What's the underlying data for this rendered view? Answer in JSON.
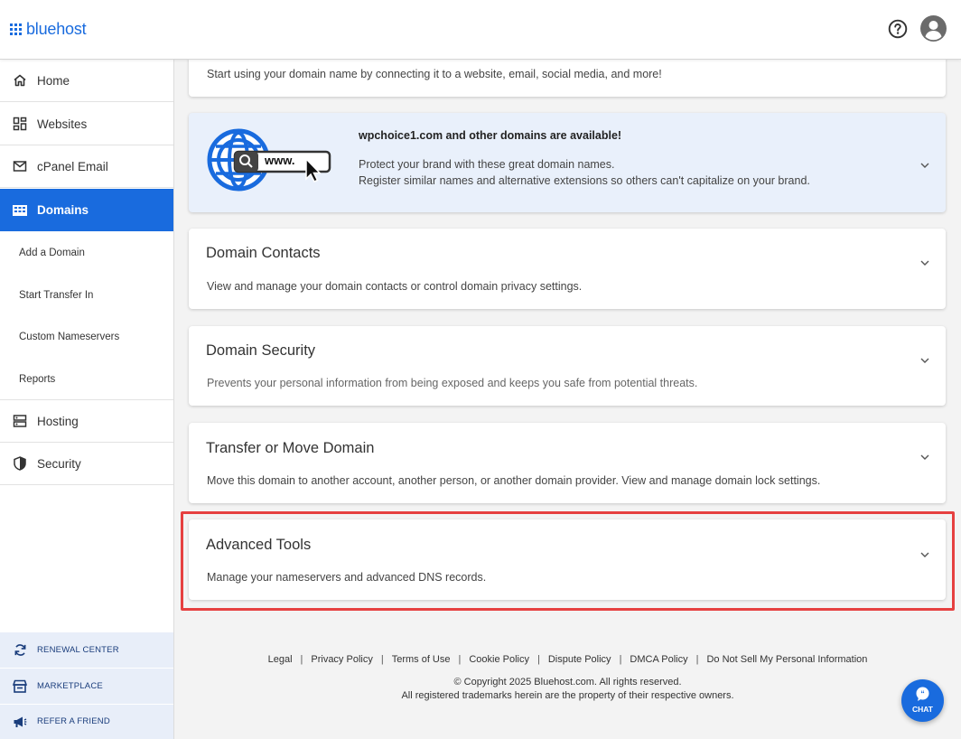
{
  "brand": {
    "name": "bluehost",
    "color": "#196bde"
  },
  "header": {
    "help_icon": "question-circle-icon",
    "avatar_icon": "user-avatar-icon"
  },
  "sidebar": {
    "items": [
      {
        "label": "Home",
        "icon": "home-icon"
      },
      {
        "label": "Websites",
        "icon": "dashboard-grid-icon"
      },
      {
        "label": "cPanel Email",
        "icon": "envelope-icon"
      },
      {
        "label": "Domains",
        "icon": "domains-building-icon",
        "active": true
      },
      {
        "label": "Hosting",
        "icon": "server-icon"
      },
      {
        "label": "Security",
        "icon": "shield-icon"
      }
    ],
    "sub_items": [
      {
        "label": "Add a Domain"
      },
      {
        "label": "Start Transfer In"
      },
      {
        "label": "Custom Nameservers"
      },
      {
        "label": "Reports"
      }
    ],
    "bottom": [
      {
        "label": "RENEWAL CENTER",
        "icon": "refresh-icon"
      },
      {
        "label": "MARKETPLACE",
        "icon": "store-icon"
      },
      {
        "label": "REFER A FRIEND",
        "icon": "megaphone-icon"
      }
    ]
  },
  "main": {
    "top_card": {
      "desc": "Start using your domain name by connecting it to a website, email, social media, and more!"
    },
    "promo": {
      "title": "wpchoice1.com and other domains are available!",
      "line1": "Protect your brand with these great domain names.",
      "line2": "Register similar names and alternative extensions so others can't capitalize on your brand.",
      "www_text": "www."
    },
    "cards": [
      {
        "title": "Domain Contacts",
        "desc": "View and manage your domain contacts or control domain privacy settings."
      },
      {
        "title": "Domain Security",
        "desc": "Prevents your personal information from being exposed and keeps you safe from potential threats."
      },
      {
        "title": "Transfer or Move Domain",
        "desc": "Move this domain to another account, another person, or another domain provider. View and manage domain lock settings."
      },
      {
        "title": "Advanced Tools",
        "desc": "Manage your nameservers and advanced DNS records."
      }
    ]
  },
  "footer": {
    "links": [
      "Legal",
      "Privacy Policy",
      "Terms of Use",
      "Cookie Policy",
      "Dispute Policy",
      "DMCA Policy",
      "Do Not Sell My Personal Information"
    ],
    "separator": "|",
    "copyright": "© Copyright 2025 Bluehost.com. All rights reserved.",
    "trademark": "All registered trademarks herein are the property of their respective owners."
  },
  "chat": {
    "label": "CHAT"
  },
  "colors": {
    "active_nav": "#196bde",
    "highlight_border": "#e64040",
    "promo_bg": "#e9f0fb"
  }
}
